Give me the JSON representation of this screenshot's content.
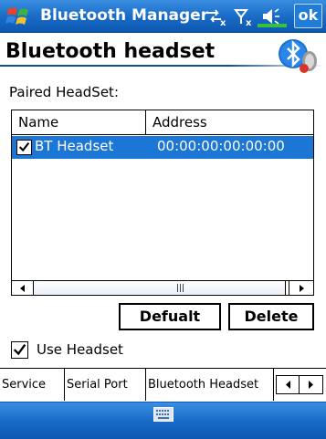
{
  "titlebar": {
    "app_title": "Bluetooth Manager",
    "ok_label": "ok",
    "icons": [
      "windows-flag-icon",
      "connectivity-icon",
      "signal-off-icon",
      "speaker-icon"
    ]
  },
  "header": {
    "title": "Bluetooth headset",
    "logo": "bluetooth-headset-logo"
  },
  "paired_label": "Paired HeadSet:",
  "list": {
    "columns": [
      "Name",
      "Address"
    ],
    "rows": [
      {
        "checked": true,
        "name": "BT Headset",
        "address": "00:00:00:00:00:00",
        "selected": true
      }
    ]
  },
  "buttons": {
    "default_label": "Defualt",
    "delete_label": "Delete"
  },
  "use_headset": {
    "checked": true,
    "label": "Use Headset"
  },
  "tabs": [
    {
      "label": "Service"
    },
    {
      "label": "Serial Port"
    },
    {
      "label": "Bluetooth Headset",
      "active": true
    }
  ],
  "colors": {
    "titlebar": "#1a6cc8",
    "selection": "#1c76d6"
  }
}
